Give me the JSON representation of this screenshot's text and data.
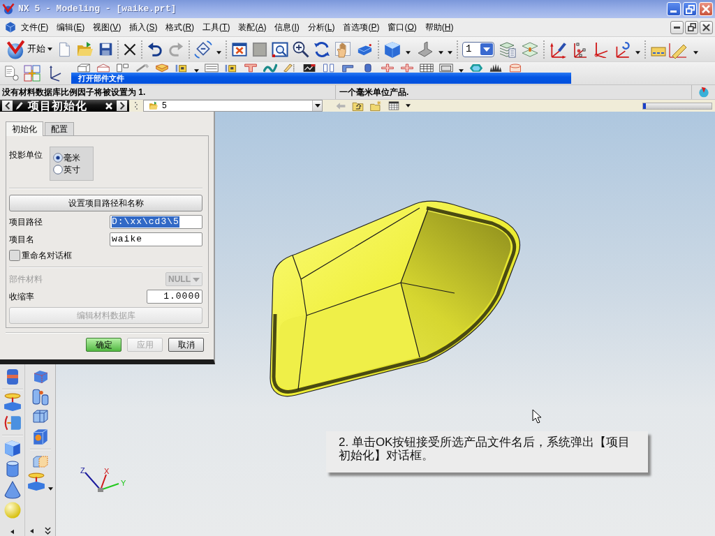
{
  "window": {
    "title": "NX 5 - Modeling - [waike.prt]"
  },
  "menu": {
    "items": [
      "文件(F)",
      "编辑(E)",
      "视图(V)",
      "插入(S)",
      "格式(R)",
      "工具(T)",
      "装配(A)",
      "信息(I)",
      "分析(L)",
      "首选项(P)",
      "窗口(O)",
      "帮助(H)"
    ]
  },
  "toolbar": {
    "start_label": "开始",
    "layer": "1"
  },
  "background_window": {
    "title": "打开部件文件"
  },
  "status_bar": {
    "prompt": "没有材料数据库比例因子将被设置为 1.",
    "message": "一个毫米单位产品."
  },
  "address_bar": {
    "folder": "5"
  },
  "dialog": {
    "title": "项目初始化",
    "tabs": [
      {
        "label": "初始化",
        "selected": true
      },
      {
        "label": "配置",
        "selected": false
      }
    ],
    "units": {
      "label": "投影单位",
      "options": [
        {
          "label": "毫米",
          "selected": true
        },
        {
          "label": "英寸",
          "selected": false
        }
      ]
    },
    "path_button": "设置项目路径和名称",
    "fields": [
      {
        "label": "项目路径",
        "value": "D:\\xx\\cd3\\5",
        "highlighted": true
      },
      {
        "label": "项目名",
        "value": "waike",
        "highlighted": false
      }
    ],
    "rename": {
      "label": "重命名对话框",
      "checked": false
    },
    "material": {
      "label": "部件材料",
      "value": "NULL",
      "disabled": true
    },
    "shrinkage": {
      "label": "收缩率",
      "value": "1.0000"
    },
    "database_button": {
      "label": "编辑材料数据库",
      "disabled": true
    },
    "buttons": [
      {
        "label": "确定",
        "default": true,
        "disabled": false
      },
      {
        "label": "应用",
        "default": false,
        "disabled": true
      },
      {
        "label": "取消",
        "default": false,
        "disabled": false
      }
    ]
  },
  "viewport": {
    "axes": {
      "x": "X",
      "y": "Y",
      "z": "Z"
    },
    "callout": "2. 单击OK按钮接受所选产品文件名后，系统弹出【项目初始化】对话框。"
  }
}
